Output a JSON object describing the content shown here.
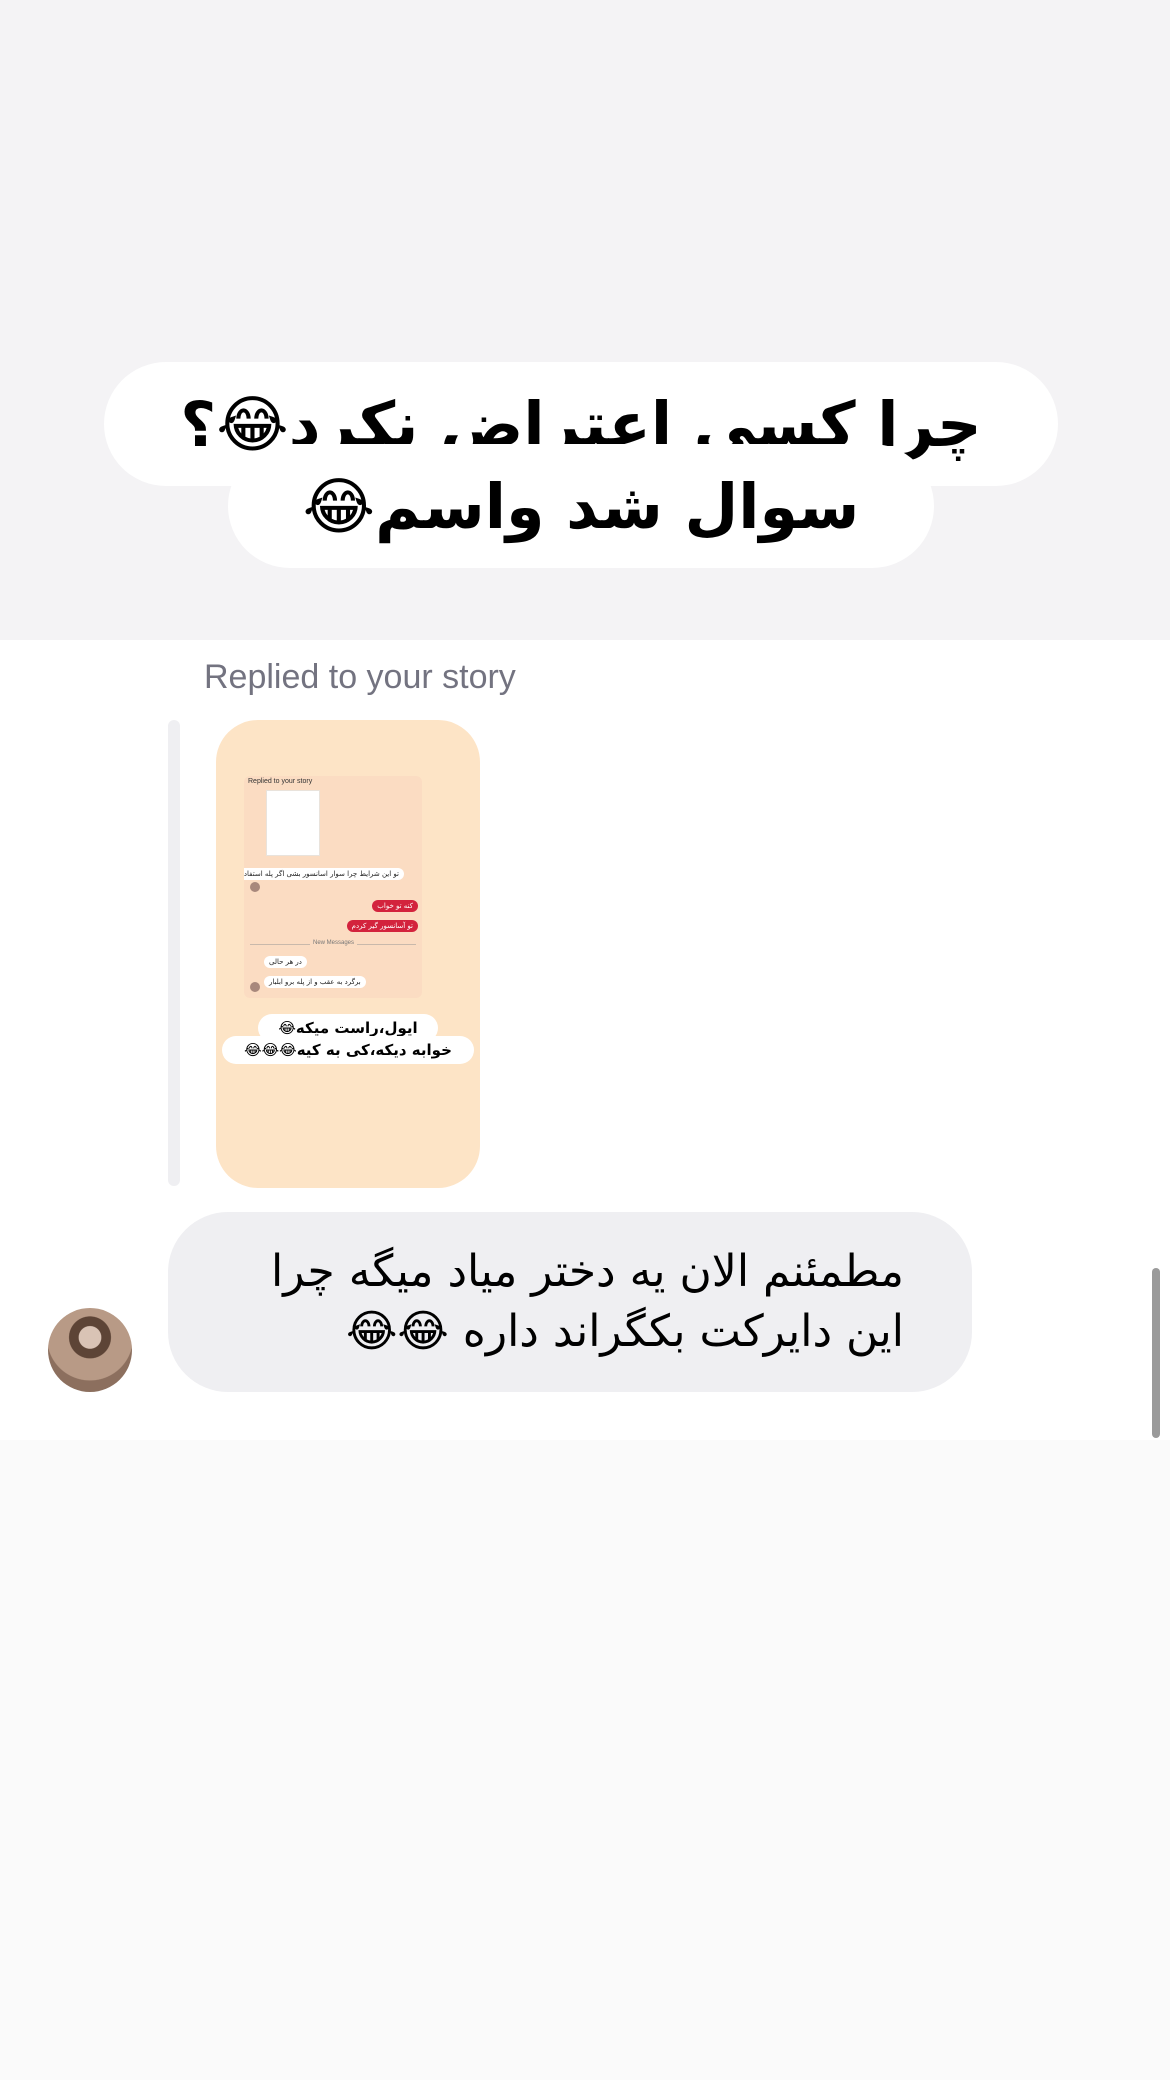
{
  "caption": {
    "line1": "چرا کسی اعتراض نکرد😂؟",
    "line2": "سوال شد واسم😂"
  },
  "thread": {
    "replied_label": "Replied to your story",
    "story_preview": {
      "header": "Replied to your story",
      "messages": [
        {
          "dir": "in",
          "text": "تو این شرایط چرا سوار اسانسور بشی اگر پله استفاده کن لطفا"
        },
        {
          "dir": "out",
          "text": "کنه تو خواب"
        },
        {
          "dir": "out",
          "text": "تو آسانسور گیر کردم"
        },
        {
          "dir": "in",
          "text": "در هر حالی"
        },
        {
          "dir": "in",
          "text": "برگرد به عقب و از پله برو ابلبار"
        }
      ],
      "divider": "New Messages",
      "caption_line1": "ایول،راست میکه😂",
      "caption_line2": "خوابه دیکه،کی به کیه😂😂😂"
    },
    "message": "مطمئنم الان یه دختر میاد میگه چرا این دایرکت بکگراند داره 😂😂"
  },
  "colors": {
    "bubble_bg": "#efeff2",
    "story_bg": "#fde4c6",
    "outgoing": "#d3233d",
    "label_gray": "#737380"
  }
}
